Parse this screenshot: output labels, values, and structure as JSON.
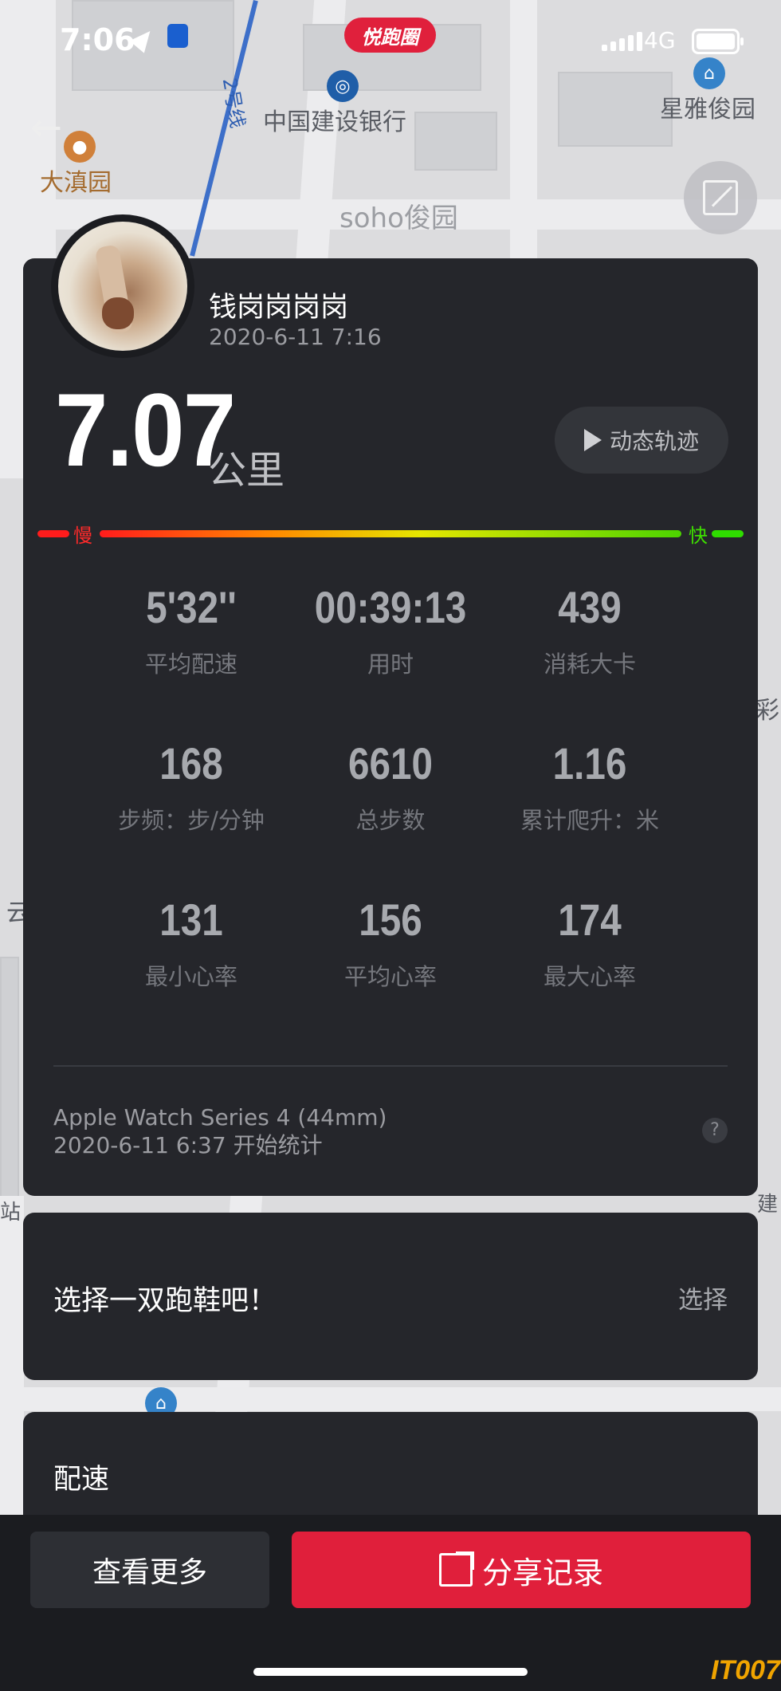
{
  "status_bar": {
    "time": "7:06",
    "network": "4G",
    "app_badge": "悦跑圈"
  },
  "map": {
    "labels": {
      "bank": "中国建设银行",
      "line2": "2号线",
      "star": "星雅俊园",
      "garden": "大滇园",
      "soho": "soho俊园",
      "cai": "彩",
      "yun": "云",
      "jian": "建",
      "zhan": "站"
    }
  },
  "profile": {
    "name": "钱岗岗岗岗",
    "date": "2020-6-11 7:16"
  },
  "summary": {
    "distance": "7.07",
    "unit": "公里",
    "track_button": "动态轨迹"
  },
  "pace_scale": {
    "slow": "慢",
    "fast": "快"
  },
  "stats": [
    {
      "value": "5'32''",
      "label": "平均配速"
    },
    {
      "value": "00:39:13",
      "label": "用时"
    },
    {
      "value": "439",
      "label": "消耗大卡"
    },
    {
      "value": "168",
      "label": "步频：步/分钟"
    },
    {
      "value": "6610",
      "label": "总步数"
    },
    {
      "value": "1.16",
      "label": "累计爬升：米"
    },
    {
      "value": "131",
      "label": "最小心率"
    },
    {
      "value": "156",
      "label": "平均心率"
    },
    {
      "value": "174",
      "label": "最大心率"
    }
  ],
  "device": {
    "name": "Apple Watch Series 4 (44mm)",
    "start": "2020-6-11 6:37 开始统计",
    "help": "?"
  },
  "shoe": {
    "label": "选择一双跑鞋吧！",
    "action": "选择"
  },
  "pace_section": {
    "title": "配速"
  },
  "actions": {
    "more": "查看更多",
    "share": "分享记录"
  },
  "watermark": "IT007"
}
